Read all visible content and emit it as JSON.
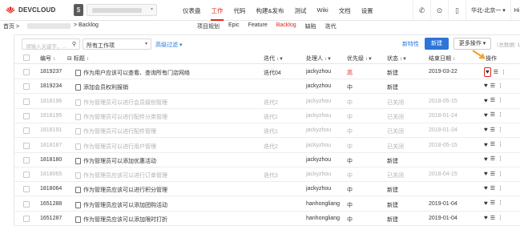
{
  "brand": {
    "name": "DEVCLOUD",
    "accent": "#e1251b",
    "link": "#2e75d9"
  },
  "main_nav": [
    {
      "label": "仪表盘",
      "active": false
    },
    {
      "label": "工作",
      "active": true
    },
    {
      "label": "代码",
      "active": false
    },
    {
      "label": "构建&发布",
      "active": false
    },
    {
      "label": "测试",
      "active": false
    },
    {
      "label": "Wiki",
      "active": false
    },
    {
      "label": "文档",
      "active": false
    },
    {
      "label": "设置",
      "active": false
    }
  ],
  "top_right": {
    "region": "华北-北京一 ▾",
    "user": "Hi jac"
  },
  "breadcrumb": {
    "home": "首页 >",
    "current": "> Backlog"
  },
  "sub_nav": [
    {
      "label": "项目规划",
      "active": false
    },
    {
      "label": "Epic",
      "active": false
    },
    {
      "label": "Feature",
      "active": false
    },
    {
      "label": "Backlog",
      "active": true
    },
    {
      "label": "缺陷",
      "active": false
    },
    {
      "label": "迭代",
      "active": false
    }
  ],
  "toolbar": {
    "search_placeholder": "请输入关键字，...",
    "work_type": "所有工作项",
    "advanced_filter": "高级过滤 ▾",
    "new_feature": "新特性",
    "new_button": "新建",
    "more_actions": "更多操作 ▾",
    "total": "（总数据: 1"
  },
  "columns": {
    "id": "编号",
    "title": "标题",
    "iteration": "迭代",
    "assignee": "处理人",
    "priority": "优先级",
    "status": "状态",
    "end_date": "结束日期",
    "actions": "操作"
  },
  "rows": [
    {
      "id": "1819237",
      "title": "作为用户应该可以查看、查询所有门店网络",
      "iteration": "迭代04",
      "assignee": "jackyzhou",
      "priority": "高",
      "status": "新建",
      "end_date": "2019-03-22",
      "closed": false,
      "high": true
    },
    {
      "id": "1819234",
      "title": "添加会员权利报销",
      "iteration": "",
      "assignee": "jackyzhou",
      "priority": "中",
      "status": "新建",
      "end_date": "",
      "closed": false,
      "high": false
    },
    {
      "id": "1818196",
      "title": "作为管理员可以进行会员级别管理",
      "iteration": "迭代2",
      "assignee": "jackyzhou",
      "priority": "中",
      "status": "已关闭",
      "end_date": "2018-05-15",
      "closed": true,
      "high": false
    },
    {
      "id": "1818195",
      "title": "作为管理员可以进行配件分类管理",
      "iteration": "迭代1",
      "assignee": "jackyzhou",
      "priority": "中",
      "status": "已关闭",
      "end_date": "2018-01-24",
      "closed": true,
      "high": false
    },
    {
      "id": "1818191",
      "title": "作为管理员可以进行配件管理",
      "iteration": "迭代1",
      "assignee": "jackyzhou",
      "priority": "中",
      "status": "已关闭",
      "end_date": "2018-01-24",
      "closed": true,
      "high": false
    },
    {
      "id": "1818187",
      "title": "作为管理员可以进行用户管理",
      "iteration": "迭代2",
      "assignee": "jackyzhou",
      "priority": "中",
      "status": "已关闭",
      "end_date": "2018-05-15",
      "closed": true,
      "high": false
    },
    {
      "id": "1818180",
      "title": "作为管理员可以添加优惠活动",
      "iteration": "",
      "assignee": "jackyzhou",
      "priority": "中",
      "status": "新建",
      "end_date": "",
      "closed": false,
      "high": false
    },
    {
      "id": "1818065",
      "title": "作为管理员应该可以进行订单管理",
      "iteration": "迭代3",
      "assignee": "jackyzhou",
      "priority": "中",
      "status": "已关闭",
      "end_date": "2018-04-15",
      "closed": true,
      "high": false
    },
    {
      "id": "1818064",
      "title": "作为管理员应该可以进行积分管理",
      "iteration": "",
      "assignee": "jackyzhou",
      "priority": "中",
      "status": "新建",
      "end_date": "",
      "closed": false,
      "high": false
    },
    {
      "id": "1651288",
      "title": "作为管理员应该可以添加团购活动",
      "iteration": "",
      "assignee": "hanhongliang",
      "priority": "中",
      "status": "新建",
      "end_date": "2019-01-04",
      "closed": false,
      "high": false
    },
    {
      "id": "1651287",
      "title": "作为管理员应该可以添加限时打折",
      "iteration": "",
      "assignee": "hanhongliang",
      "priority": "中",
      "status": "新建",
      "end_date": "2019-01-04",
      "closed": false,
      "high": false
    }
  ]
}
